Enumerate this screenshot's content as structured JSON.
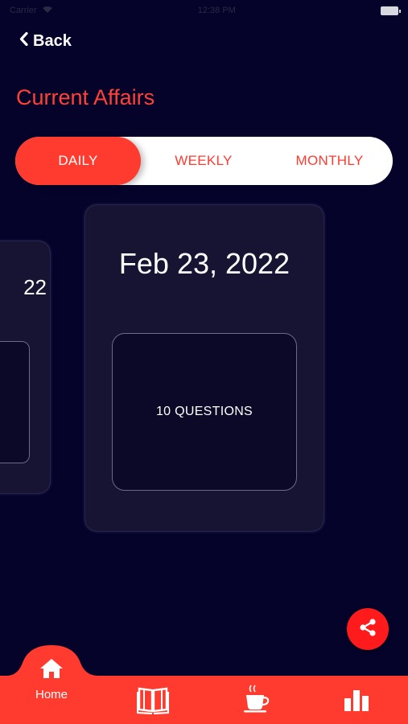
{
  "header": {
    "back_label": "Back",
    "title": "Current Affairs"
  },
  "tabs": [
    {
      "label": "DAILY",
      "active": true
    },
    {
      "label": "WEEKLY",
      "active": false
    },
    {
      "label": "MONTHLY",
      "active": false
    }
  ],
  "cards": {
    "main": {
      "date": "Feb 23, 2022",
      "questions_label": "10 QUESTIONS"
    },
    "side": {
      "date_fragment": "22"
    }
  },
  "bottom_nav": {
    "items": [
      {
        "label": "Home",
        "icon": "home-icon",
        "active": true
      },
      {
        "label": "",
        "icon": "book-icon"
      },
      {
        "label": "",
        "icon": "coffee-icon"
      },
      {
        "label": "",
        "icon": "bar-chart-icon"
      }
    ]
  },
  "colors": {
    "background": "#05032a",
    "accent": "#ff3b30",
    "card": "#161333",
    "white": "#ffffff"
  }
}
